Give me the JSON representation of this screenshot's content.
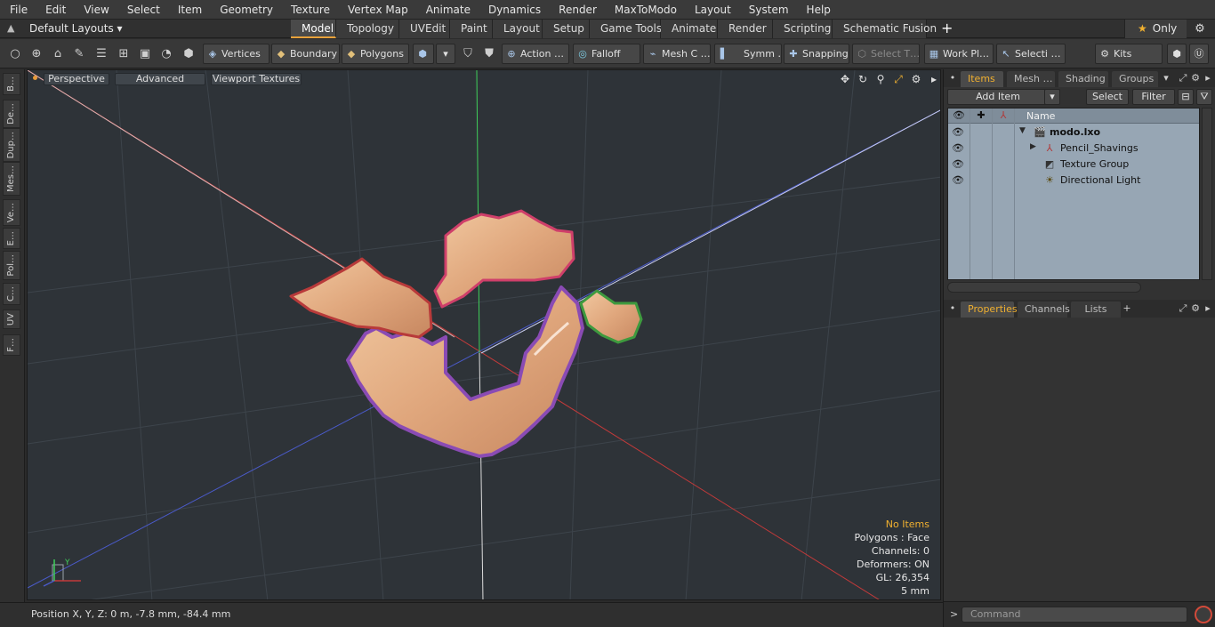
{
  "menu": [
    "File",
    "Edit",
    "View",
    "Select",
    "Item",
    "Geometry",
    "Texture",
    "Vertex Map",
    "Animate",
    "Dynamics",
    "Render",
    "MaxToModo",
    "Layout",
    "System",
    "Help"
  ],
  "layout_bar": {
    "layouts_label": "Default Layouts ▾",
    "tabs": [
      "Model",
      "Topology",
      "UVEdit",
      "Paint",
      "Layout",
      "Setup",
      "Game Tools",
      "Animate",
      "Render",
      "Scripting",
      "Schematic Fusion"
    ],
    "active_tab": "Model",
    "only_label": "Only"
  },
  "toolbar": {
    "vertices": "Vertices",
    "boundary": "Boundary",
    "polygons": "Polygons",
    "action": "Action …",
    "falloff": "Falloff",
    "mesh": "Mesh C …",
    "symm": "Symm …",
    "snapping": "Snapping",
    "select_t": "Select T…",
    "work_pl": "Work Pl…",
    "selecti": "Selecti …",
    "kits": "Kits"
  },
  "left_tabs": [
    "B…",
    "De…",
    "Dup…",
    "Mes…",
    "Ve…",
    "E…",
    "Pol…",
    "C…",
    "UV",
    "F…"
  ],
  "viewport": {
    "perspective": "Perspective",
    "advanced": "Advanced",
    "viewport_textures": "Viewport Textures",
    "info": {
      "no_items": "No Items",
      "polygons": "Polygons : Face",
      "channels": "Channels: 0",
      "deformers": "Deformers: ON",
      "gl": "GL: 26,354",
      "scale": "5 mm"
    },
    "axis_label": "Y"
  },
  "statusbar": {
    "position": "Position X, Y, Z:   0 m, -7.8 mm, -84.4 mm"
  },
  "right_panel": {
    "top_tabs": [
      "Items",
      "Mesh …",
      "Shading",
      "Groups"
    ],
    "active_top_tab": "Items",
    "add_item": "Add Item",
    "select": "Select",
    "filter": "Filter",
    "name_col": "Name",
    "tree": [
      {
        "label": "modo.lxo",
        "bold": true,
        "level": 0
      },
      {
        "label": "Pencil_Shavings",
        "level": 1
      },
      {
        "label": "Texture Group",
        "level": 1
      },
      {
        "label": "Directional Light",
        "level": 1
      }
    ],
    "bottom_tabs": [
      "Properties",
      "Channels",
      "Lists"
    ],
    "active_bottom_tab": "Properties",
    "command_placeholder": "Command"
  }
}
